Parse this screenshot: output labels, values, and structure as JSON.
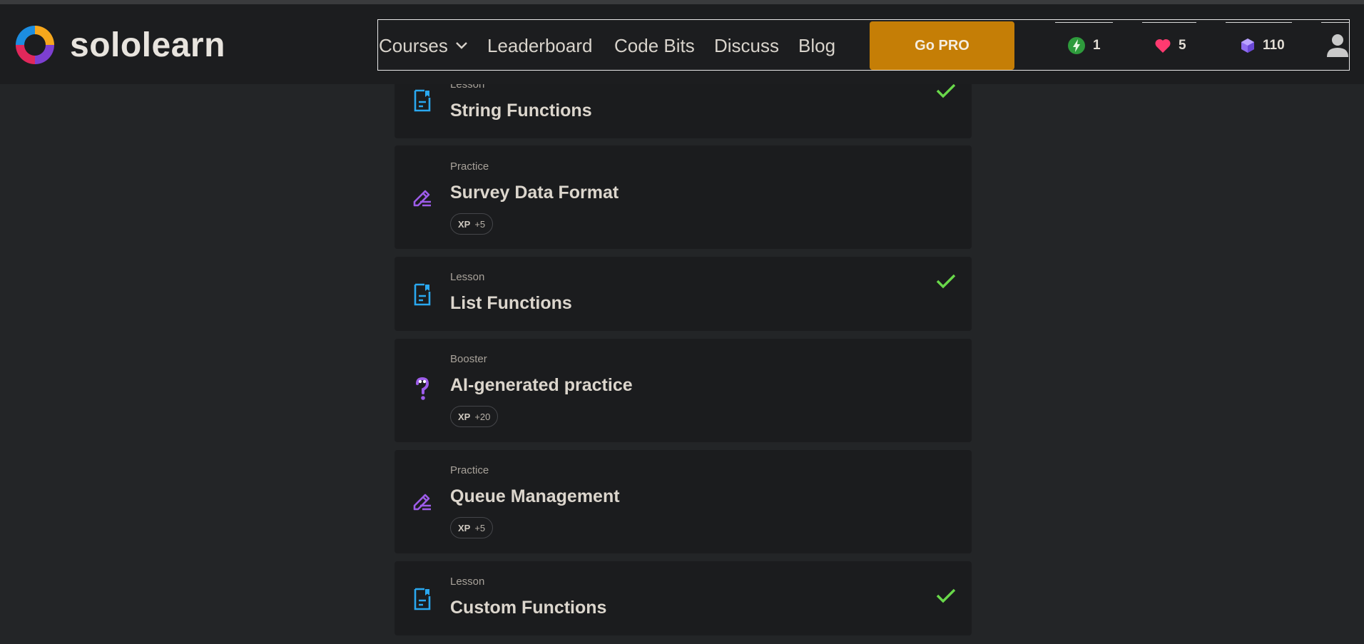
{
  "brand": {
    "name": "sololearn"
  },
  "nav": {
    "courses": "Courses",
    "leaderboard": "Leaderboard",
    "codebits": "Code Bits",
    "discuss": "Discuss",
    "blog": "Blog",
    "gopro": "Go PRO"
  },
  "stats": {
    "streak": "1",
    "hearts": "5",
    "gems": "110"
  },
  "colors": {
    "accent": "#c57e06",
    "lesson_icon": "#2aa8f0",
    "practice_icon": "#9d5ce9",
    "check": "#69d84a",
    "heart": "#ff3a70"
  },
  "items": [
    {
      "type": "Lesson",
      "title": "String Functions",
      "icon": "lesson-icon",
      "completed": true
    },
    {
      "type": "Practice",
      "title": "Survey Data Format",
      "icon": "practice-icon",
      "xp_label": "XP",
      "xp_value": "+5"
    },
    {
      "type": "Lesson",
      "title": "List Functions",
      "icon": "lesson-icon",
      "completed": true
    },
    {
      "type": "Booster",
      "title": "AI-generated practice",
      "icon": "booster-icon",
      "xp_label": "XP",
      "xp_value": "+20"
    },
    {
      "type": "Practice",
      "title": "Queue Management",
      "icon": "practice-icon",
      "xp_label": "XP",
      "xp_value": "+5"
    },
    {
      "type": "Lesson",
      "title": "Custom Functions",
      "icon": "lesson-icon",
      "completed": true
    }
  ]
}
